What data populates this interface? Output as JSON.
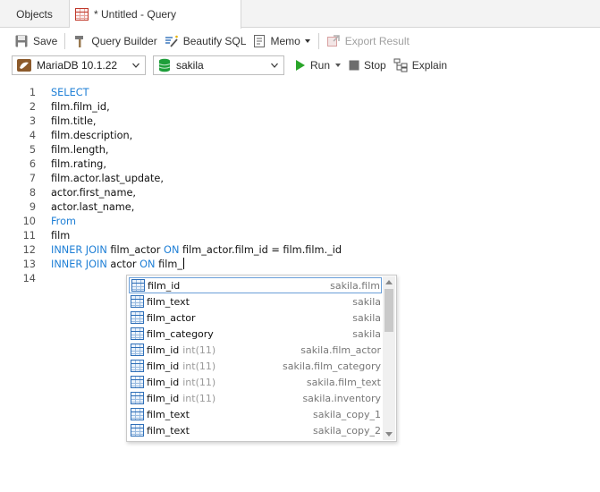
{
  "tabs": {
    "objects": "Objects",
    "query": "* Untitled - Query"
  },
  "toolbar": {
    "save": "Save",
    "query_builder": "Query Builder",
    "beautify": "Beautify SQL",
    "memo": "Memo",
    "export": "Export Result"
  },
  "toolbar2": {
    "connection": "MariaDB 10.1.22",
    "database": "sakila",
    "run": "Run",
    "stop": "Stop",
    "explain": "Explain"
  },
  "editor": {
    "lines": [
      {
        "n": "1",
        "kw": "SELECT",
        "text": ""
      },
      {
        "n": "2",
        "kw": "",
        "text": "film.film_id,"
      },
      {
        "n": "3",
        "kw": "",
        "text": "film.title,"
      },
      {
        "n": "4",
        "kw": "",
        "text": "film.description,"
      },
      {
        "n": "5",
        "kw": "",
        "text": "film.length,"
      },
      {
        "n": "6",
        "kw": "",
        "text": "film.rating,"
      },
      {
        "n": "7",
        "kw": "",
        "text": "film.actor.last_update,"
      },
      {
        "n": "8",
        "kw": "",
        "text": "actor.first_name,"
      },
      {
        "n": "9",
        "kw": "",
        "text": "actor.last_name,"
      },
      {
        "n": "10",
        "kw": "From",
        "text": ""
      },
      {
        "n": "11",
        "kw": "",
        "text": "film"
      },
      {
        "n": "12",
        "kw": "INNER JOIN",
        "text": "film_actor",
        "kw2": "ON",
        "text2": "film_actor.film_id = film.film._id"
      },
      {
        "n": "13",
        "kw": "INNER JOIN",
        "text": "actor",
        "kw2": "ON",
        "text2": "film_"
      },
      {
        "n": "14",
        "kw": "",
        "text": ""
      }
    ]
  },
  "autocomplete": {
    "items": [
      {
        "name": "film_id",
        "type": "",
        "scope": "sakila.film",
        "selected": true
      },
      {
        "name": "film_text",
        "type": "",
        "scope": "sakila"
      },
      {
        "name": "film_actor",
        "type": "",
        "scope": "sakila"
      },
      {
        "name": "film_category",
        "type": "",
        "scope": "sakila"
      },
      {
        "name": "film_id",
        "type": "int(11)",
        "scope": "sakila.film_actor"
      },
      {
        "name": "film_id",
        "type": "int(11)",
        "scope": "sakila.film_category"
      },
      {
        "name": "film_id",
        "type": "int(11)",
        "scope": "sakila.film_text"
      },
      {
        "name": "film_id",
        "type": "int(11)",
        "scope": "sakila.inventory"
      },
      {
        "name": "film_text",
        "type": "",
        "scope": "sakila_copy_1"
      },
      {
        "name": "film_text",
        "type": "",
        "scope": "sakila_copy_2"
      }
    ]
  },
  "colors": {
    "keyword": "#1e7fd6",
    "run_green": "#2aa52a",
    "db_green": "#1e9e3a",
    "selection_border": "#6a9fd8"
  }
}
